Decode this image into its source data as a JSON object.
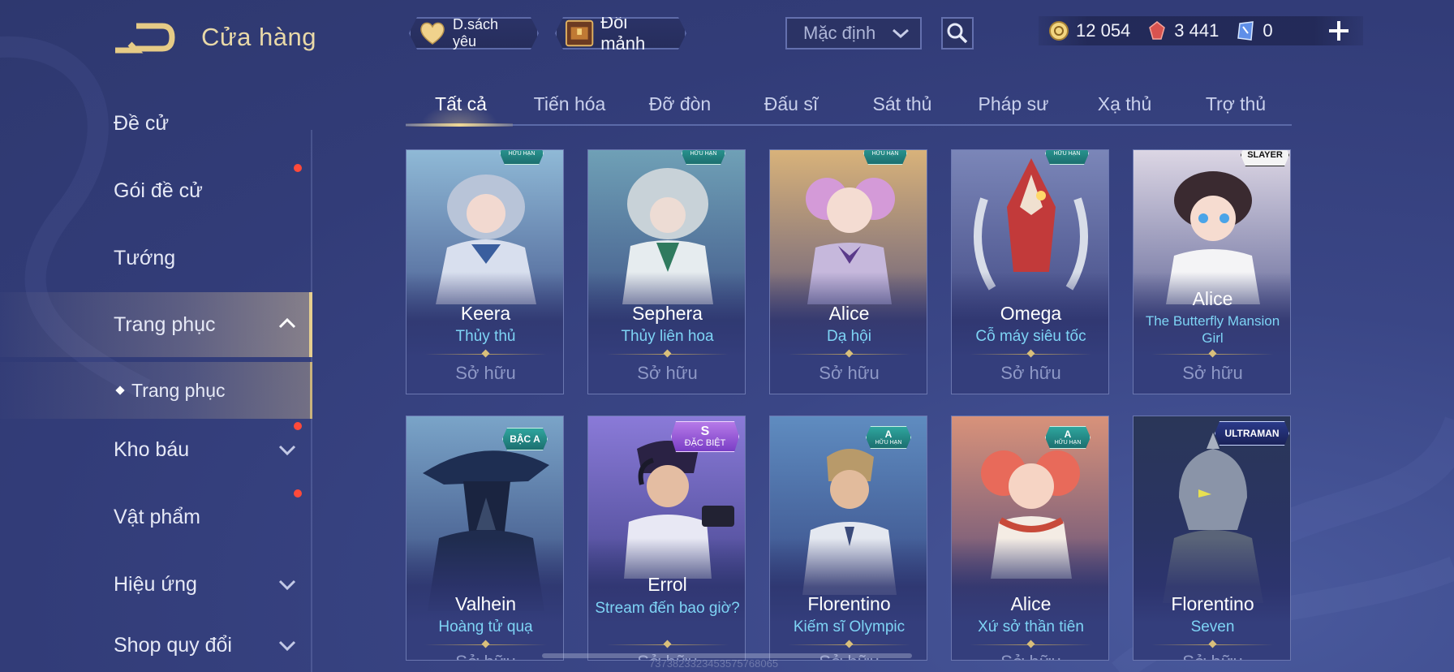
{
  "header": {
    "title": "Cửa hàng",
    "favorites_label": "D.sách yêu",
    "shard_exchange_label": "Đổi mảnh",
    "sort_selected": "Mặc định"
  },
  "currencies": [
    {
      "name": "gold",
      "value": "12 054",
      "icon": "gold-coin-icon",
      "color": "#e9c765"
    },
    {
      "name": "gem",
      "value": "3 441",
      "icon": "red-gem-icon",
      "color": "#d04a4a"
    },
    {
      "name": "voucher",
      "value": "0",
      "icon": "blue-voucher-icon",
      "color": "#8ab6ff"
    }
  ],
  "sidebar": {
    "items": [
      {
        "label": "Đề cử"
      },
      {
        "label": "Gói đề cử"
      },
      {
        "label": "Tướng"
      },
      {
        "label": "Trang phục"
      },
      {
        "label": "Trang phục"
      },
      {
        "label": "Kho báu"
      },
      {
        "label": "Vật phẩm"
      },
      {
        "label": "Hiệu ứng"
      },
      {
        "label": "Shop quy đổi"
      }
    ]
  },
  "tabs": [
    "Tất cả",
    "Tiến hóa",
    "Đỡ đòn",
    "Đấu sĩ",
    "Sát thủ",
    "Pháp sư",
    "Xạ thủ",
    "Trợ thủ"
  ],
  "cards": [
    {
      "hero": "Keera",
      "skin": "Thủy thủ",
      "status": "Sở hữu",
      "badge_lim": "HỮU HẠN",
      "color": "#5fa0c8"
    },
    {
      "hero": "Sephera",
      "skin": "Thủy liên hoa",
      "status": "Sở hữu",
      "badge_lim": "HỮU HẠN",
      "color": "#4c8fa8"
    },
    {
      "hero": "Alice",
      "skin": "Dạ hội",
      "status": "Sở hữu",
      "badge_lim": "HỮU HẠN",
      "color": "#c79ad8"
    },
    {
      "hero": "Omega",
      "skin": "Cỗ máy siêu tốc",
      "status": "Sở hữu",
      "badge_lim": "HỮU HẠN",
      "color": "#b84848"
    },
    {
      "hero": "Alice",
      "skin": "The Butterfly Mansion Girl",
      "status": "Sở hữu",
      "badge_text": "SLAYER",
      "color": "#d9d2dc"
    },
    {
      "hero": "Valhein",
      "skin": "Hoàng tử quạ",
      "status": "Sở hữu",
      "badge_tier": "BẬC A",
      "color": "#2e5e8a"
    },
    {
      "hero": "Errol",
      "skin": "Stream đến bao giờ?",
      "status": "Sở hữu",
      "badge_tier": "S",
      "badge_lim": "ĐẶC BIỆT",
      "color": "#7a6ac8"
    },
    {
      "hero": "Florentino",
      "skin": "Kiếm sĩ Olympic",
      "status": "Sở hữu",
      "badge_tier": "A",
      "badge_lim": "HỮU HẠN",
      "color": "#5f86b2"
    },
    {
      "hero": "Alice",
      "skin": "Xứ sở thần tiên",
      "status": "Sở hữu",
      "badge_tier": "A",
      "badge_lim": "HỮU HẠN",
      "color": "#d8716a"
    },
    {
      "hero": "Florentino",
      "skin": "Seven",
      "status": "Sở hữu",
      "badge_text": "ULTRAMAN",
      "color": "#3a4e7e"
    }
  ],
  "footer_id": "7373823323453575768065"
}
